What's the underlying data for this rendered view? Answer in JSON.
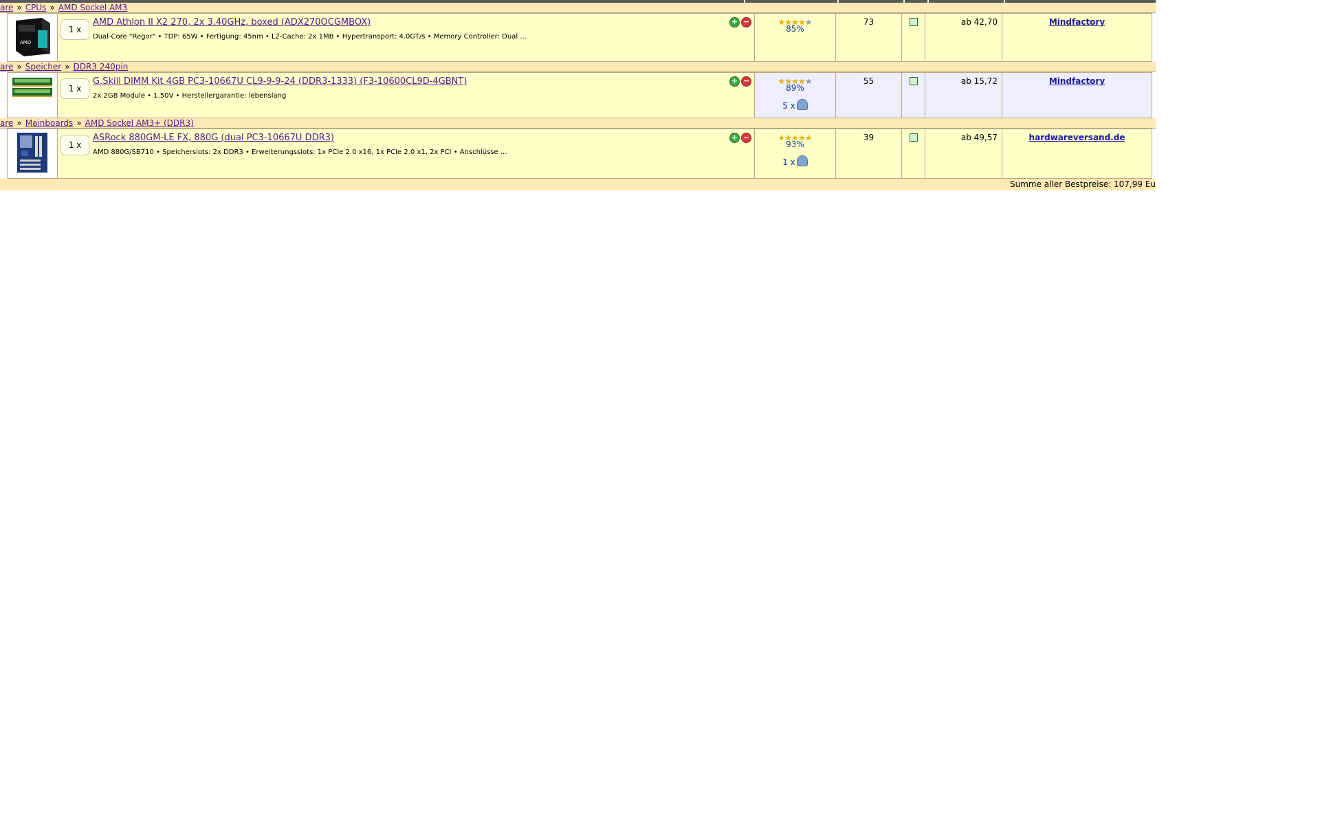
{
  "products": [
    {
      "breadcrumb": [
        "are",
        "CPUs",
        "AMD Sockel AM3"
      ],
      "qty": "1 x",
      "title": "AMD Athlon II X2 270, 2x 3.40GHz, boxed (ADX270OCGMBOX)",
      "description": "Dual-Core \"Regor\" • TDP: 65W • Fertigung: 45nm • L2-Cache: 2x 1MB • Hypertransport: 4.0GT/s • Memory Controller: Dual ...",
      "rating_stars": 4,
      "rating_pct": "85%",
      "reviews": "",
      "number": "73",
      "price": "ab 42,70",
      "shop": "Mindfactory",
      "image_icon": "cpu-box-image"
    },
    {
      "breadcrumb": [
        "are",
        "Speicher",
        "DDR3 240pin"
      ],
      "qty": "1 x",
      "title": "G.Skill DIMM Kit 4GB PC3-10667U CL9-9-9-24 (DDR3-1333) (F3-10600CL9D-4GBNT)",
      "description": "2x 2GB Module • 1.50V • Herstellergarantie: lebenslang",
      "rating_stars": 4,
      "rating_pct": "89%",
      "reviews": "5 x",
      "number": "55",
      "price": "ab 15,72",
      "shop": "Mindfactory",
      "image_icon": "ram-modules-image"
    },
    {
      "breadcrumb": [
        "are",
        "Mainboards",
        "AMD Sockel AM3+ (DDR3)"
      ],
      "qty": "1 x",
      "title": "ASRock 880GM-LE FX, 880G (dual PC3-10667U DDR3)",
      "description": "AMD 880G/SB710 • Speicherslots: 2x DDR3 • Erweiterungsslots: 1x PCIe 2.0 x16, 1x PCIe 2.0 x1, 2x PCI • Anschlüsse ...",
      "rating_stars": 5,
      "rating_pct": "93%",
      "reviews": "1 x",
      "number": "39",
      "price": "ab 49,57",
      "shop": "hardwareversand.de",
      "image_icon": "motherboard-image"
    }
  ],
  "summary": "Summe aller Bestpreise: 107,99 Eu",
  "colors": {
    "row_yellow": "#ffffc8",
    "row_blue": "#eeeefc",
    "crumb_bg": "#fde9b4",
    "link": "#551a8b"
  }
}
